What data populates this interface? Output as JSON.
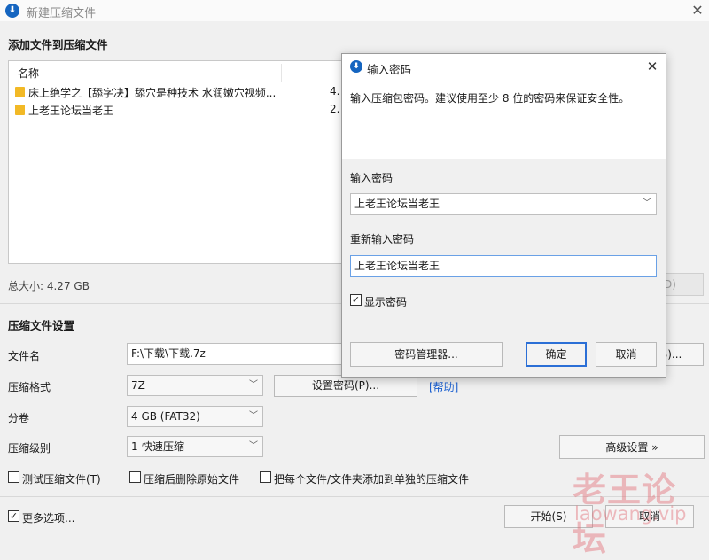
{
  "window": {
    "title": "新建压缩文件",
    "icon": "archive-app-icon",
    "close_glyph": "✕"
  },
  "add_files": {
    "section_title": "添加文件到压缩文件",
    "column_name": "名称",
    "files": [
      {
        "name": "床上绝学之【舔字决】舔穴是种技术 水润嫩穴视频...",
        "size": "4."
      },
      {
        "name": "上老王论坛当老王",
        "size": "2."
      }
    ],
    "total_size": "总大小: 4.27 GB",
    "hidden_button_label": "D)"
  },
  "settings": {
    "section_title": "压缩文件设置",
    "filename_label": "文件名",
    "filename_value": "F:\\下载\\下载.7z",
    "browse_button_label": "B)...",
    "format_label": "压缩格式",
    "format_value": "7Z",
    "set_password_button": "设置密码(P)...",
    "help_link": "[帮助]",
    "volume_label": "分卷",
    "volume_value": "4 GB (FAT32)",
    "level_label": "压缩级别",
    "level_value": "1-快速压缩",
    "advanced_button": "高级设置 »",
    "test_archive_label": "测试压缩文件(T)",
    "delete_after_label": "压缩后删除原始文件",
    "separate_archive_label": "把每个文件/文件夹添加到单独的压缩文件",
    "test_archive_checked": false,
    "delete_after_checked": false,
    "separate_archive_checked": false
  },
  "footer": {
    "more_options_label": "更多选项...",
    "more_options_checked": true,
    "start_button": "开始(S)",
    "cancel_button": "取消"
  },
  "password_dialog": {
    "title": "输入密码",
    "description": "输入压缩包密码。建议使用至少 8 位的密码来保证安全性。",
    "password_label": "输入密码",
    "password_value": "上老王论坛当老王",
    "reenter_label": "重新输入密码",
    "reenter_value": "上老王论坛当老王",
    "show_password_label": "显示密码",
    "show_password_checked": true,
    "manager_button": "密码管理器...",
    "ok_button": "确定",
    "cancel_button": "取消"
  },
  "watermark": {
    "line1": "老王论坛",
    "line2": "laowang.vip"
  },
  "colors": {
    "accent": "#2b6fd6",
    "link": "#1a5fd0",
    "folder": "#f2b926",
    "watermark": "#e26e78"
  }
}
